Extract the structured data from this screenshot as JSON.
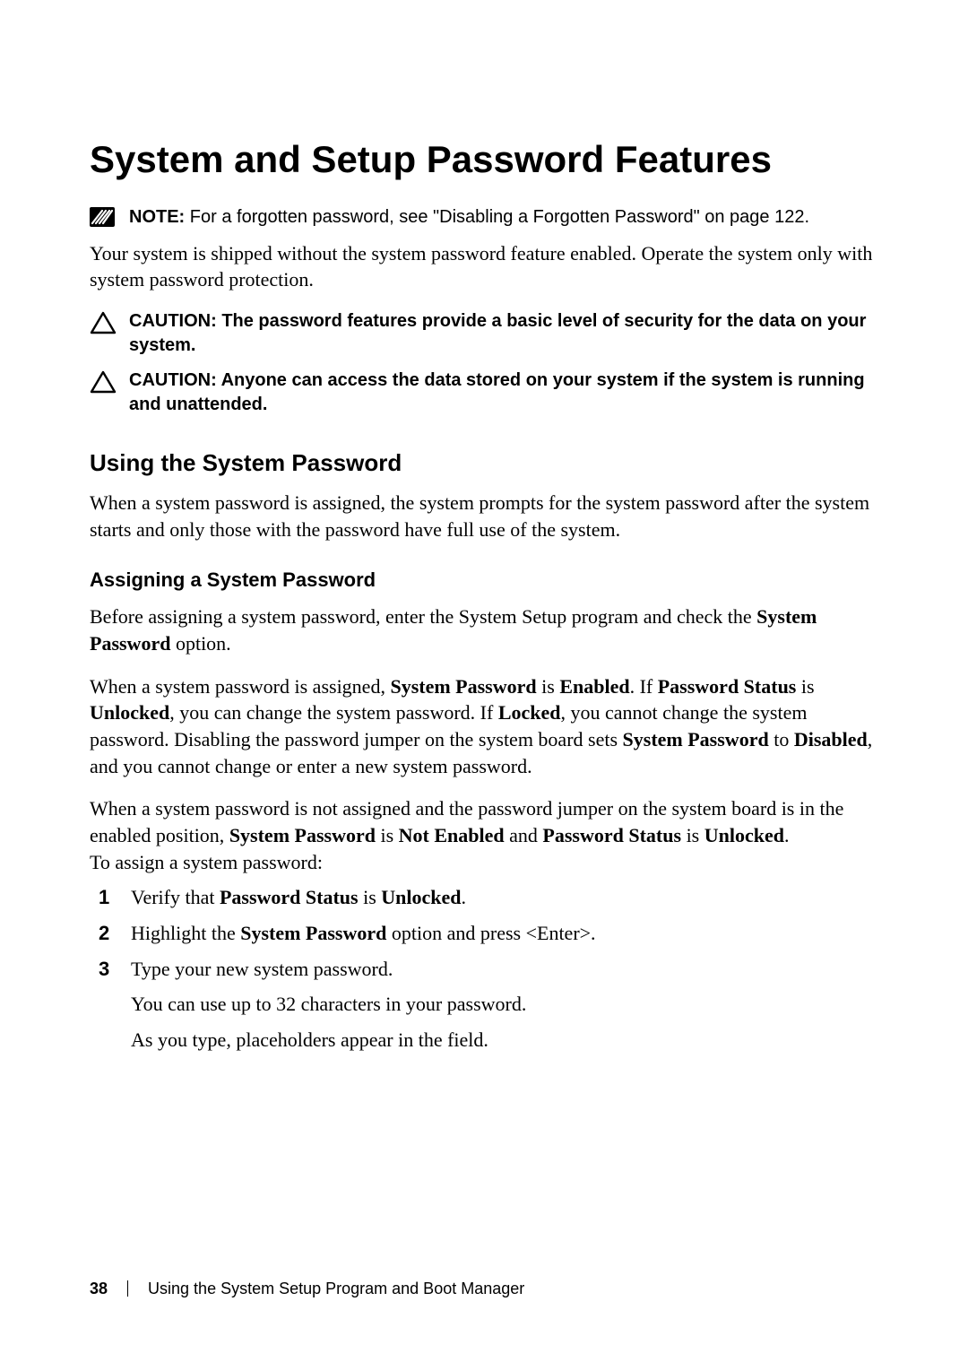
{
  "heading": "System and Setup Password Features",
  "note": {
    "label": "NOTE:",
    "text": " For a forgotten password, see \"Disabling a Forgotten Password\" on page 122."
  },
  "intro": "Your system is shipped without the system password feature enabled. Operate the system only with system password protection.",
  "caution1": {
    "label": "CAUTION:",
    "text": " The password features provide a basic level of security for the data on your system."
  },
  "caution2": {
    "label": "CAUTION:",
    "text": " Anyone can access the data stored on your system if the system is running and unattended."
  },
  "sub1_heading": "Using the System Password",
  "sub1_body": "When a system password is assigned, the system prompts for the system password after the system starts and only those with the password have full use of the system.",
  "sub2_heading": "Assigning a System Password",
  "p1_a": "Before assigning a system password, enter the System Setup program and check the ",
  "p1_b": "System Password",
  "p1_c": " option.",
  "p2_a": "When a system password is assigned, ",
  "p2_b": "System Password",
  "p2_c": " is ",
  "p2_d": "Enabled",
  "p2_e": ". If ",
  "p2_f": "Password Status",
  "p2_g": " is ",
  "p2_h": "Unlocked",
  "p2_i": ", you can change the system password. If ",
  "p2_j": "Locked",
  "p2_k": ", you cannot change the system password. Disabling the password jumper on the system board sets ",
  "p2_l": "System Password",
  "p2_m": " to ",
  "p2_n": "Disabled",
  "p2_o": ", and you cannot change or enter a new system password.",
  "p3_a": "When a system password is not assigned and the password jumper on the system board is in the enabled position, ",
  "p3_b": "System Password",
  "p3_c": " is ",
  "p3_d": "Not Enabled",
  "p3_e": " and ",
  "p3_f": "Password Status",
  "p3_g": " is ",
  "p3_h": "Unlocked",
  "p3_i": ".",
  "p3_tail": "To assign a system password:",
  "steps": {
    "s1_a": "Verify that ",
    "s1_b": "Password Status",
    "s1_c": " is ",
    "s1_d": "Unlocked",
    "s1_e": ".",
    "s2_a": "Highlight the ",
    "s2_b": "System Password",
    "s2_c": " option and press <Enter>.",
    "s3_a": "Type your new system password.",
    "s3_b": "You can use up to 32 characters in your password.",
    "s3_c": "As you type, placeholders appear in the field."
  },
  "num1": "1",
  "num2": "2",
  "num3": "3",
  "footer": {
    "page": "38",
    "section": "Using the System Setup Program and Boot Manager"
  }
}
